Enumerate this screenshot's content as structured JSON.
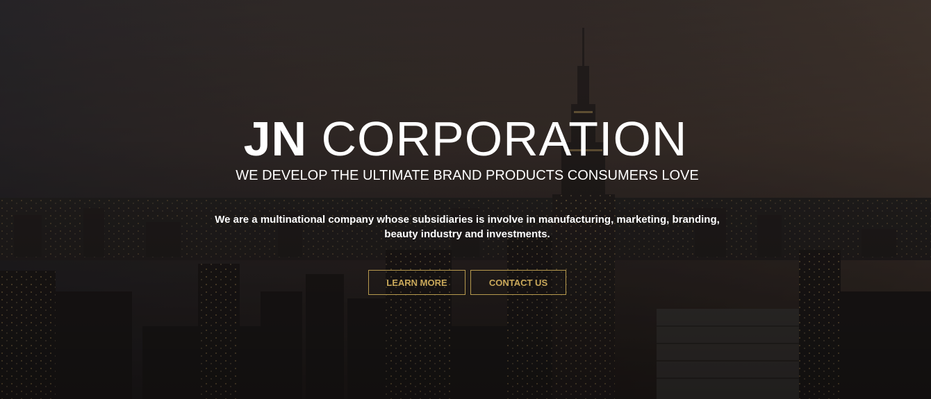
{
  "hero": {
    "title_bold": "JN",
    "title_light": " CORPORATION",
    "subtitle": "WE DEVELOP THE ULTIMATE BRAND PRODUCTS CONSUMERS LOVE",
    "description_line1": "We are a multinational company whose subsidiaries is involve in manufacturing, marketing, branding,",
    "description_line2": "beauty industry and investments.",
    "buttons": {
      "learn_more": "LEARN MORE",
      "contact_us": "CONTACT US"
    }
  },
  "colors": {
    "accent": "#c9a85a",
    "overlay": "#2a2320",
    "text": "#ffffff"
  },
  "background_image": "city-skyline-at-dusk"
}
